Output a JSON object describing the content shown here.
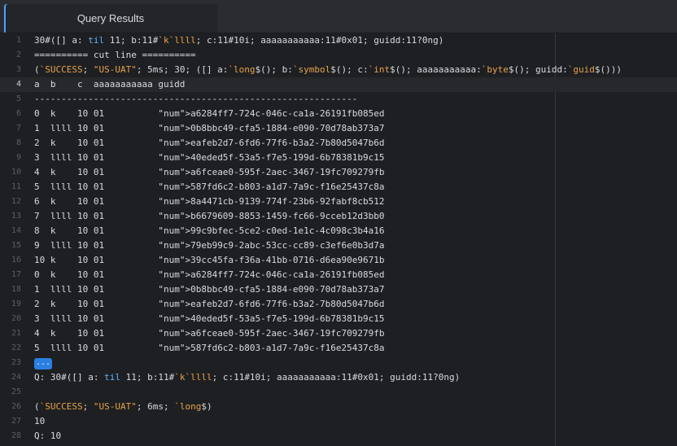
{
  "tab": {
    "label": "Query Results"
  },
  "lines": [
    {
      "n": "1",
      "t": "30#([] a: til 11; b:11#`k`llll; c:11#10i; aaaaaaaaaaa:11#0x01; guidd:11?0ng)"
    },
    {
      "n": "2",
      "t": "========== cut line =========="
    },
    {
      "n": "3",
      "t": "(`SUCCESS; \"US-UAT\"; 5ms; 30; ([] a:`long$(); b:`symbol$(); c:`int$(); aaaaaaaaaaa:`byte$(); guidd:`guid$()))"
    },
    {
      "n": "4",
      "t": "a  b    c  aaaaaaaaaaa guidd",
      "active": true
    },
    {
      "n": "5",
      "t": "------------------------------------------------------------"
    },
    {
      "n": "6",
      "t": "0  k    10 01          a6284ff7-724c-046c-ca1a-26191fb085ed"
    },
    {
      "n": "7",
      "t": "1  llll 10 01          0b8bbc49-cfa5-1884-e090-70d78ab373a7"
    },
    {
      "n": "8",
      "t": "2  k    10 01          eafeb2d7-6fd6-77f6-b3a2-7b80d5047b6d"
    },
    {
      "n": "9",
      "t": "3  llll 10 01          40eded5f-53a5-f7e5-199d-6b78381b9c15"
    },
    {
      "n": "10",
      "t": "4  k    10 01          a6fceae0-595f-2aec-3467-19fc709279fb"
    },
    {
      "n": "11",
      "t": "5  llll 10 01          587fd6c2-b803-a1d7-7a9c-f16e25437c8a"
    },
    {
      "n": "12",
      "t": "6  k    10 01          8a4471cb-9139-774f-23b6-92fabf8cb512"
    },
    {
      "n": "13",
      "t": "7  llll 10 01          b6679609-8853-1459-fc66-9cceb12d3bb0"
    },
    {
      "n": "14",
      "t": "8  k    10 01          99c9bfec-5ce2-c0ed-1e1c-4c098c3b4a16"
    },
    {
      "n": "15",
      "t": "9  llll 10 01          79eb99c9-2abc-53cc-cc89-c3ef6e0b3d7a"
    },
    {
      "n": "16",
      "t": "10 k    10 01          39cc45fa-f36a-41bb-0716-d6ea90e9671b"
    },
    {
      "n": "17",
      "t": "0  k    10 01          a6284ff7-724c-046c-ca1a-26191fb085ed"
    },
    {
      "n": "18",
      "t": "1  llll 10 01          0b8bbc49-cfa5-1884-e090-70d78ab373a7"
    },
    {
      "n": "19",
      "t": "2  k    10 01          eafeb2d7-6fd6-77f6-b3a2-7b80d5047b6d"
    },
    {
      "n": "20",
      "t": "3  llll 10 01          40eded5f-53a5-f7e5-199d-6b78381b9c15"
    },
    {
      "n": "21",
      "t": "4  k    10 01          a6fceae0-595f-2aec-3467-19fc709279fb"
    },
    {
      "n": "22",
      "t": "5  llll 10 01          587fd6c2-b803-a1d7-7a9c-f16e25437c8a"
    },
    {
      "n": "23",
      "t": "...",
      "ellipsis": true
    },
    {
      "n": "24",
      "t": "Q: 30#([] a: til 11; b:11#`k`llll; c:11#10i; aaaaaaaaaaa:11#0x01; guidd:11?0ng)"
    },
    {
      "n": "25",
      "t": ""
    },
    {
      "n": "26",
      "t": "(`SUCCESS; \"US-UAT\"; 6ms; `long$)"
    },
    {
      "n": "27",
      "t": "10"
    },
    {
      "n": "28",
      "t": "Q: 10"
    }
  ],
  "colors": {
    "keyword": "#5fb4ff",
    "value": "#e6a34a",
    "text": "#d7dae0"
  }
}
